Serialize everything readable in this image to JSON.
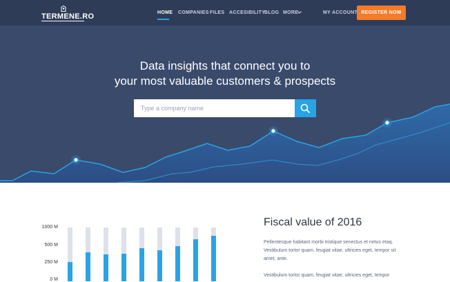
{
  "brand": {
    "name": "TERMENE.RO"
  },
  "nav": {
    "items": [
      {
        "label": "HOME",
        "active": true
      },
      {
        "label": "COMPANIES",
        "active": false
      },
      {
        "label": "FILES",
        "active": false
      },
      {
        "label": "ACCESIBILITY",
        "active": false
      },
      {
        "label": "BLOG",
        "active": false
      },
      {
        "label": "MORE",
        "active": false
      }
    ],
    "account_label": "MY ACCOUNT",
    "register_label": "REGISTER NOW"
  },
  "hero": {
    "headline_line1": "Data insights that connect you to",
    "headline_line2": "your most valuable customers & prospects",
    "search_placeholder": "Type a company name"
  },
  "fiscal": {
    "title": "Fiscal value of 2016",
    "paragraph1": "Pellentesque habitant morbi tristique senectus et netus etaq. Vestibulum tortor quam, feugiat vitae, ultricies eget, tempor sit amet, ante.",
    "paragraph2": "Vestibulum tortor quam, feugiat vitae, ultricies eget, tempor"
  },
  "chart_data": {
    "type": "bar",
    "y_ticks": [
      "1000 M",
      "500 M",
      "250 M",
      "0 M"
    ],
    "ylim": [
      0,
      1000
    ],
    "values": [
      360,
      540,
      500,
      515,
      620,
      580,
      660,
      780,
      840
    ]
  },
  "colors": {
    "hero_bg": "#3a4a6b",
    "nav_bg": "#2f3c58",
    "accent_blue": "#2aa3e6",
    "register_orange": "#f47b2a",
    "bar_track": "#dde1ea"
  },
  "icons": {
    "brand": "brand-logo-icon",
    "more": "chevron-down-icon",
    "search": "search-icon"
  }
}
